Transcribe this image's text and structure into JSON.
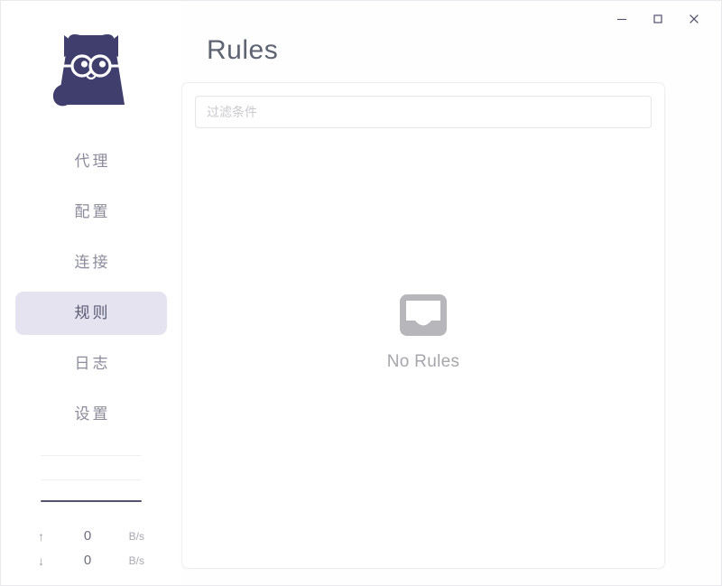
{
  "window": {
    "controls": [
      {
        "name": "minimize-button",
        "icon": "minimize-icon",
        "label": "–"
      },
      {
        "name": "maximize-button",
        "icon": "maximize-icon",
        "label": "□"
      },
      {
        "name": "close-button",
        "icon": "close-icon",
        "label": "✕"
      }
    ]
  },
  "sidebar": {
    "logo": {
      "icon": "cat-logo-icon",
      "color": "#403e6d"
    },
    "items": [
      {
        "label": "代理",
        "name": "proxies",
        "active": false
      },
      {
        "label": "配置",
        "name": "profiles",
        "active": false
      },
      {
        "label": "连接",
        "name": "connections",
        "active": false
      },
      {
        "label": "规则",
        "name": "rules",
        "active": true
      },
      {
        "label": "日志",
        "name": "logs",
        "active": false
      },
      {
        "label": "设置",
        "name": "settings",
        "active": false
      }
    ],
    "traffic": {
      "chart_baseline_color": "#53536e",
      "rows": [
        {
          "arrow": "↑",
          "direction": "upload",
          "value": "0",
          "unit": "B/s"
        },
        {
          "arrow": "↓",
          "direction": "download",
          "value": "0",
          "unit": "B/s"
        }
      ]
    }
  },
  "main": {
    "title": "Rules",
    "filter": {
      "value": "",
      "placeholder": "过滤条件"
    },
    "empty": {
      "icon": "inbox-icon",
      "text": "No Rules"
    }
  },
  "colors": {
    "accent": "#403e6d",
    "active_bg": "#e5e3f0",
    "title": "#5e6472",
    "muted": "#a6a6ac"
  }
}
